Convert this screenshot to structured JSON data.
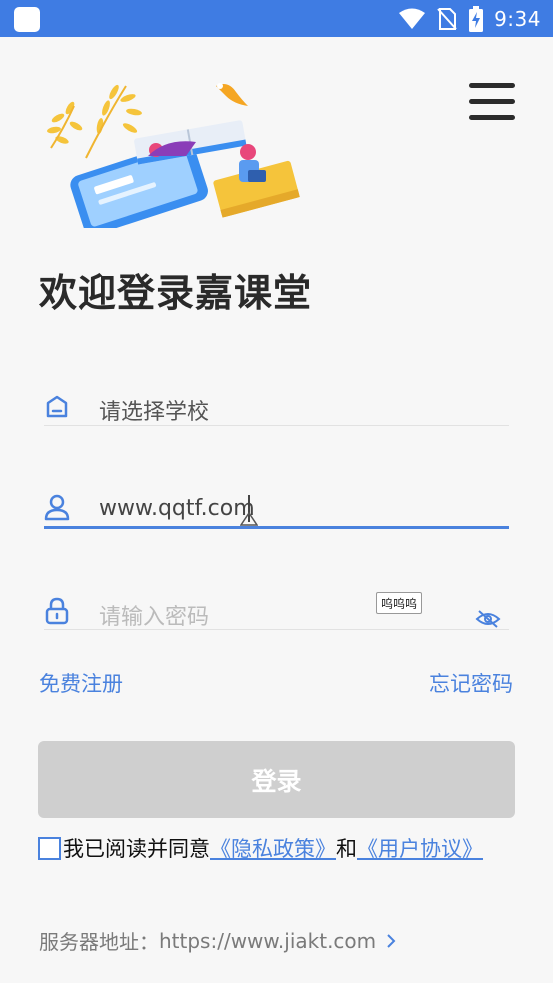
{
  "status_bar": {
    "time": "9:34"
  },
  "header": {
    "menu_icon": "hamburger-menu-icon"
  },
  "welcome": {
    "title": "欢迎登录嘉课堂"
  },
  "form": {
    "school": {
      "placeholder": "请选择学校",
      "icon": "school-building-icon"
    },
    "username": {
      "value": "www.qqtf.com",
      "icon": "user-icon"
    },
    "password": {
      "placeholder": "请输入密码",
      "icon": "lock-icon",
      "toggle_icon": "eye-hidden-icon"
    },
    "tooltip": "呜呜呜"
  },
  "links": {
    "register": "免费注册",
    "forgot_password": "忘记密码"
  },
  "login_button": {
    "label": "登录"
  },
  "agreement": {
    "prefix": "我已阅读并同意",
    "privacy_policy": "《隐私政策》",
    "and": "和",
    "user_agreement": "《用户协议》",
    "checked": false
  },
  "server": {
    "label": "服务器地址：",
    "value": "https://www.jiakt.com"
  },
  "colors": {
    "status_bar": "#3f7ce3",
    "accent": "#4a82de",
    "button_disabled": "#cfcfcf"
  }
}
